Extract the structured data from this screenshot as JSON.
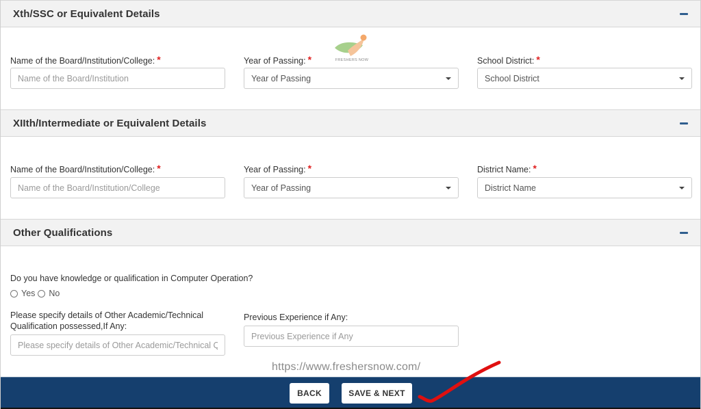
{
  "sections": [
    {
      "title": "Xth/SSC or Equivalent Details",
      "collapse_icon": "minus-icon",
      "fields": {
        "board": {
          "label": "Name of the Board/Institution/College:",
          "required_mark": "*",
          "placeholder": "Name of the Board/Institution",
          "value": ""
        },
        "year": {
          "label": "Year of Passing:",
          "required_mark": "*",
          "selected": "Year of Passing"
        },
        "district": {
          "label": "School District:",
          "required_mark": "*",
          "selected": "School District"
        }
      }
    },
    {
      "title": "XIIth/Intermediate or Equivalent Details",
      "collapse_icon": "minus-icon",
      "fields": {
        "board": {
          "label": "Name of the Board/Institution/College:",
          "required_mark": "*",
          "placeholder": "Name of the Board/Institution/College",
          "value": ""
        },
        "year": {
          "label": "Year of Passing:",
          "required_mark": "*",
          "selected": "Year of Passing"
        },
        "district": {
          "label": "District Name:",
          "required_mark": "*",
          "selected": "District Name"
        }
      }
    },
    {
      "title": "Other Qualifications",
      "collapse_icon": "minus-icon",
      "fields": {
        "computer_question": "Do you have knowledge or qualification in Computer Operation?",
        "computer_options": [
          {
            "label": "Yes",
            "checked": false
          },
          {
            "label": "No",
            "checked": false
          }
        ],
        "other_details": {
          "label_line1": "Please specify details of Other Academic/Technical",
          "label_line2": "Qualification possessed,If Any:",
          "placeholder": "Please specify details of Other Academic/Technical Qualification possessed,If Any",
          "value": ""
        },
        "experience": {
          "label": "Previous Experience if Any:",
          "placeholder": "Previous Experience if Any",
          "value": ""
        }
      }
    }
  ],
  "watermark": {
    "logo_text": "FRESHERS NOW",
    "url": "https://www.freshersnow.com/"
  },
  "footer": {
    "back_label": "BACK",
    "save_next_label": "SAVE & NEXT"
  },
  "colors": {
    "footer_bg": "#153f6e",
    "required": "#e02020",
    "collapse_icon": "#2f5e8e",
    "annotation_check": "#e01010"
  }
}
